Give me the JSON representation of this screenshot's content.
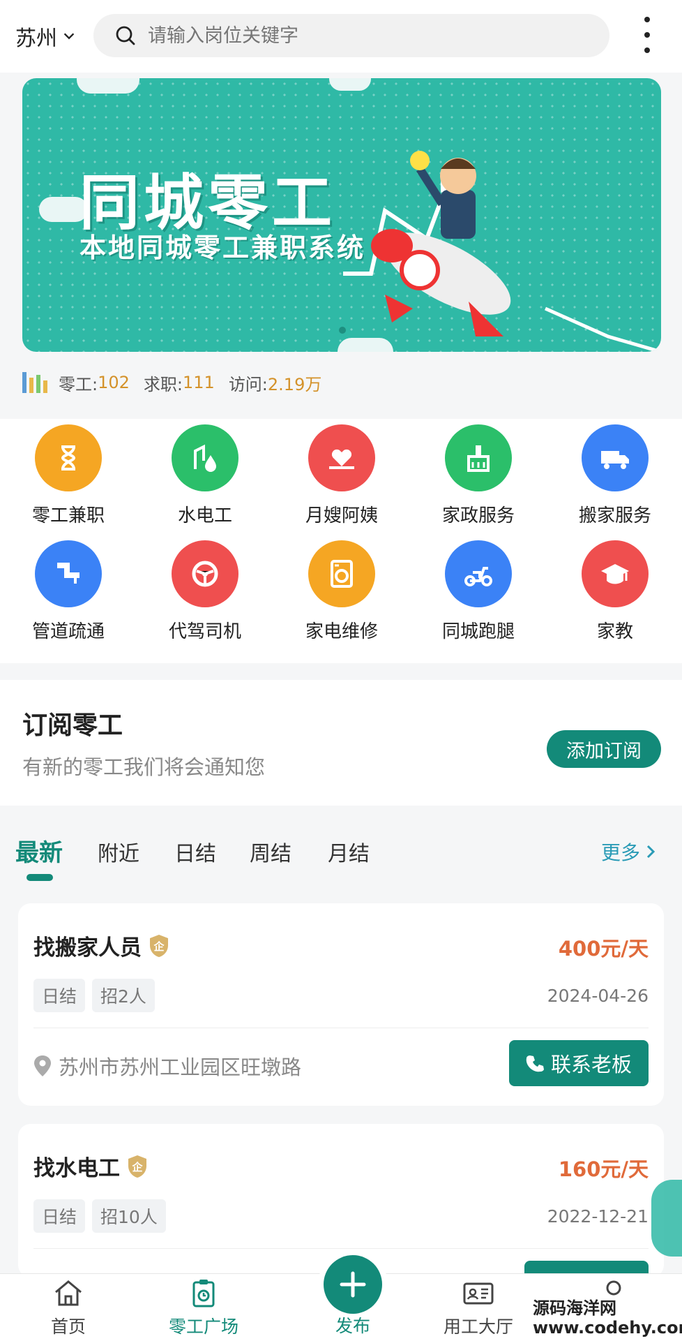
{
  "header": {
    "city": "苏州",
    "search_placeholder": "请输入岗位关键字"
  },
  "banner": {
    "title": "同城零工",
    "subtitle": "本地同城零工兼职系统"
  },
  "stats": {
    "gig_label": "零工:",
    "gig_value": "102",
    "job_label": "求职:",
    "job_value": "111",
    "visit_label": "访问:",
    "visit_value": "2.19万"
  },
  "categories": [
    {
      "label": "零工兼职",
      "color": "#f5a623",
      "icon": "hourglass-icon"
    },
    {
      "label": "水电工",
      "color": "#2bbf6a",
      "icon": "water-electric-icon"
    },
    {
      "label": "月嫂阿姨",
      "color": "#ef4f4f",
      "icon": "heart-hand-icon"
    },
    {
      "label": "家政服务",
      "color": "#2bbf6a",
      "icon": "broom-icon"
    },
    {
      "label": "搬家服务",
      "color": "#3b82f6",
      "icon": "truck-icon"
    },
    {
      "label": "管道疏通",
      "color": "#3b82f6",
      "icon": "pipe-icon"
    },
    {
      "label": "代驾司机",
      "color": "#ef4f4f",
      "icon": "steering-wheel-icon"
    },
    {
      "label": "家电维修",
      "color": "#f5a623",
      "icon": "washing-machine-icon"
    },
    {
      "label": "同城跑腿",
      "color": "#3b82f6",
      "icon": "scooter-icon"
    },
    {
      "label": "家教",
      "color": "#ef4f4f",
      "icon": "graduation-cap-icon"
    }
  ],
  "subscribe": {
    "title": "订阅零工",
    "desc": "有新的零工我们将会通知您",
    "button": "添加订阅"
  },
  "tabs": {
    "items": [
      "最新",
      "附近",
      "日结",
      "周结",
      "月结"
    ],
    "active": "最新",
    "more": "更多"
  },
  "jobs": [
    {
      "title": "找搬家人员",
      "badge": "企",
      "price": "400元/天",
      "tags": [
        "日结",
        "招2人"
      ],
      "date": "2024-04-26",
      "location": "苏州市苏州工业园区旺墩路",
      "contact": "联系老板"
    },
    {
      "title": "找水电工",
      "badge": "企",
      "price": "160元/天",
      "tags": [
        "日结",
        "招10人"
      ],
      "date": "2022-12-21"
    }
  ],
  "bottom_nav": {
    "home": "首页",
    "square": "零工广场",
    "publish": "发布",
    "hall": "用工大厅",
    "watermark_line1": "源码海洋网",
    "watermark_line2": "www.codehy.com"
  },
  "colors": {
    "brand": "#138a79",
    "price": "#e06a3a",
    "stat_value": "#d4922a",
    "banner_bg": "#2fb9a6"
  }
}
